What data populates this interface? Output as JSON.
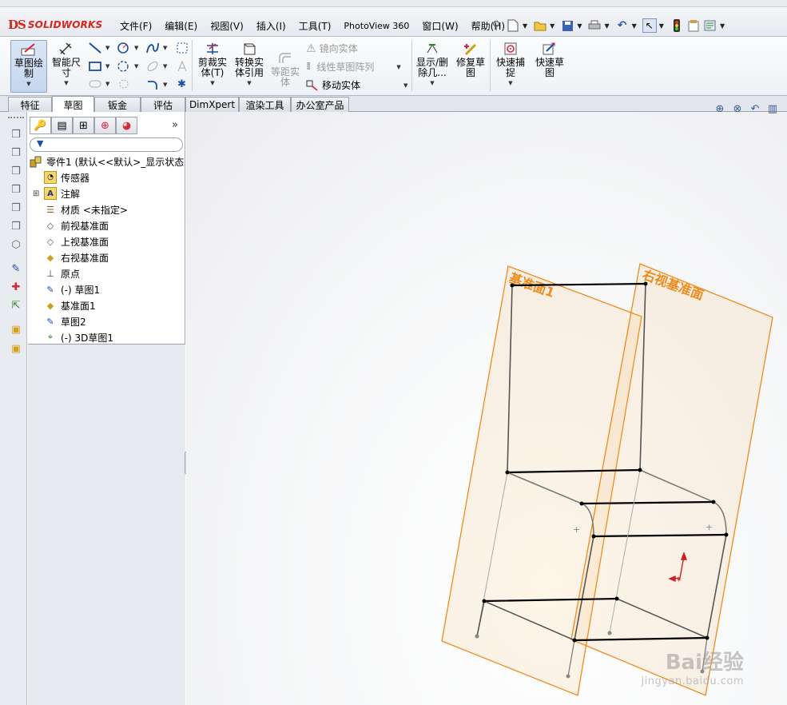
{
  "app": {
    "logo_ds": "DS",
    "logo_text": "SOLIDWORKS"
  },
  "menu": [
    "文件(F)",
    "编辑(E)",
    "视图(V)",
    "插入(I)",
    "工具(T)",
    "PhotoView 360",
    "窗口(W)",
    "帮助(H)"
  ],
  "quick_access_icons": [
    "pin-icon",
    "new-document-icon",
    "open-folder-icon",
    "save-icon",
    "print-icon",
    "undo-icon",
    "select-cursor-icon",
    "traffic-light-icon",
    "file-properties-icon",
    "options-icon"
  ],
  "ribbon": {
    "sketch": "草图绘制",
    "smart_dim": "智能尺寸",
    "trim": "剪裁实体(T)",
    "convert": "转换实体引用",
    "offset": "等距实体",
    "mirror": "镜向实体",
    "linear_pattern": "线性草图阵列",
    "move": "移动实体",
    "display_delete": "显示/删除几...",
    "repair": "修复草图",
    "quick_snap": "快速捕捉",
    "rapid_sketch": "快速草图"
  },
  "tabs": [
    "特征",
    "草图",
    "钣金",
    "评估",
    "DimXpert",
    "渲染工具",
    "办公室产品"
  ],
  "tree": {
    "root": "零件1 (默认<<默认>_显示状态",
    "items": [
      "传感器",
      "注解",
      "材质 <未指定>",
      "前视基准面",
      "上视基准面",
      "右视基准面",
      "原点",
      "(-) 草图1",
      "基准面1",
      "草图2",
      "(-) 3D草图1"
    ]
  },
  "viewport": {
    "plane1_label": "基准面1",
    "plane2_label": "右视基准面",
    "watermark_main": "Bai经验",
    "watermark_sub": "jingyan.baidu.com",
    "plane_color": "#f08a1c",
    "sketch_color": "#000000"
  }
}
